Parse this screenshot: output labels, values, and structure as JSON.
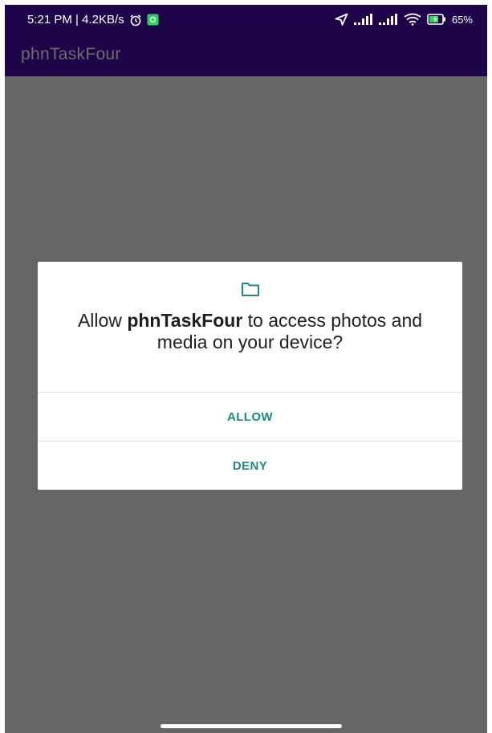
{
  "status_bar": {
    "time_speed": "5:21 PM | 4.2KB/s",
    "battery_percent": "65%",
    "icons": [
      "alarm-icon",
      "notification-app-icon",
      "location-icon",
      "signal-icon",
      "signal-icon",
      "wifi-icon",
      "battery-charging-icon"
    ]
  },
  "app_bar": {
    "title": "phnTaskFour"
  },
  "dialog": {
    "icon": "folder-icon",
    "message_prefix": "Allow ",
    "app_name": "phnTaskFour",
    "message_suffix": " to access photos and media on your device?",
    "allow_label": "ALLOW",
    "deny_label": "DENY"
  },
  "colors": {
    "app_bar": "#1e0448",
    "scrim": "#666666",
    "button_text": "#1c8a82",
    "notification_badge": "#2bd15b"
  }
}
